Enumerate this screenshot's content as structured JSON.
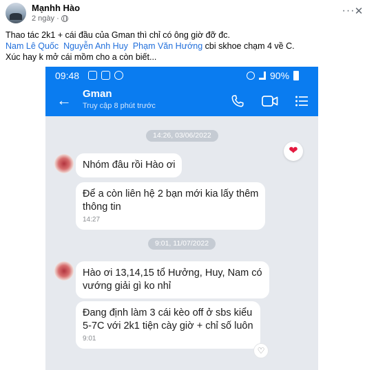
{
  "post": {
    "author": "Mạnhh Hào",
    "time": "2 ngày ·",
    "text_line1": "Thao tác 2k1 + cái đầu của Gman thì chỉ có ông giờ đỡ đc.",
    "mentions": [
      "Nam Lê Quốc",
      "Nguyễn Anh Huy",
      "Phạm Văn Hướng"
    ],
    "text_line2_suffix": " cbi skhoe chạm 4 về C.",
    "text_line3": "Xúc hay k mở cái mồm cho a còn biết...",
    "more_label": "···",
    "close_label": "✕"
  },
  "phone": {
    "status_time": "09:48",
    "battery": "90%",
    "chat_name": "Gman",
    "chat_status": "Truy cập 8 phút trước",
    "groups": [
      {
        "date": "14:26, 03/06/2022",
        "messages": [
          {
            "lines": [
              "Nhóm đâu rồi Hào ơi"
            ]
          },
          {
            "lines": [
              "Để a còn liên hệ 2 bạn mới kia lấy thêm",
              "thông tin"
            ],
            "time": "14:27"
          }
        ]
      },
      {
        "date": "9:01, 11/07/2022",
        "messages": [
          {
            "lines": [
              "Hào ơi 13,14,15 tổ Hưởng, Huy, Nam có",
              "vướng giải gì ko nhỉ"
            ]
          },
          {
            "lines": [
              "Đang định làm 3 cái kèo off ở sbs kiểu",
              "5-7C với 2k1 tiện cày giờ + chỉ số luôn"
            ],
            "time": "9:01"
          }
        ]
      }
    ]
  },
  "colors": {
    "zalo_blue": "#0a7cf0",
    "mention_blue": "#216fdb",
    "chat_bg": "#e6e9ee",
    "heart_red": "#e4193f"
  },
  "icons": [
    "globe-icon",
    "back-arrow-icon",
    "phone-icon",
    "video-icon",
    "menu-icon",
    "heart-icon",
    "like-icon"
  ]
}
